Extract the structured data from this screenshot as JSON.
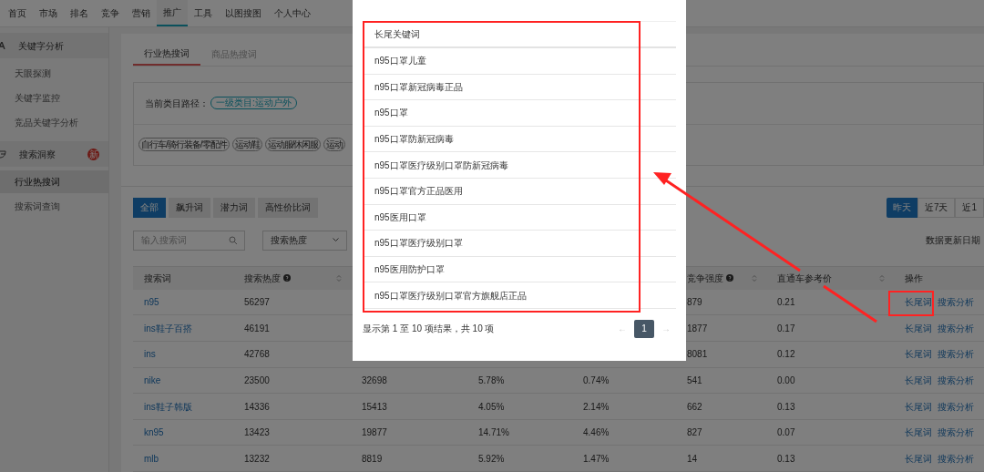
{
  "nav": [
    {
      "label": "首页",
      "selected": false
    },
    {
      "label": "市场",
      "selected": false
    },
    {
      "label": "排名",
      "selected": false
    },
    {
      "label": "竞争",
      "selected": false
    },
    {
      "label": "营销",
      "selected": false
    },
    {
      "label": "推广",
      "selected": true
    },
    {
      "label": "工具",
      "selected": false
    },
    {
      "label": "以图搜图",
      "selected": false
    },
    {
      "label": "个人中心",
      "selected": false
    }
  ],
  "sidebar": {
    "sections": [
      {
        "title": "关键字分析",
        "kind": "letter",
        "items": [
          {
            "label": "天眼探测",
            "selected": false
          },
          {
            "label": "关键字监控",
            "selected": false
          },
          {
            "label": "竞品关键字分析",
            "selected": false
          }
        ]
      },
      {
        "title": "搜索洞察",
        "kind": "scope",
        "badge": "新",
        "items": [
          {
            "label": "行业热搜词",
            "selected": true
          },
          {
            "label": "搜索词查询",
            "selected": false
          }
        ]
      }
    ]
  },
  "page_tabs": [
    {
      "label": "行业热搜词",
      "selected": true
    },
    {
      "label": "商品热搜词",
      "selected": false
    }
  ],
  "breadcrumb": {
    "label": "当前类目路径：",
    "value": "一级类目:运动户外"
  },
  "categories": [
    "自行车/骑行装备/零配件",
    "运动鞋",
    "运动服/休闲服",
    "运动"
  ],
  "filter_tabs": [
    {
      "label": "全部",
      "selected": true
    },
    {
      "label": "飙升词",
      "selected": false
    },
    {
      "label": "潜力词",
      "selected": false
    },
    {
      "label": "高性价比词",
      "selected": false
    }
  ],
  "period_tabs": [
    {
      "label": "昨天",
      "selected": true
    },
    {
      "label": "近7天",
      "selected": false
    },
    {
      "label": "近1",
      "selected": false
    }
  ],
  "search": {
    "placeholder": "输入搜索词"
  },
  "sort_select": {
    "value": "搜索热度"
  },
  "update_label": "数据更新日期",
  "table": {
    "columns": [
      {
        "label": "搜索词",
        "help": false,
        "sortable": false
      },
      {
        "label": "搜索热度",
        "help": true,
        "sortable": true
      },
      {
        "label": "竞争强度",
        "help": true,
        "sortable": true
      },
      {
        "label": "直通车参考价",
        "help": false,
        "sortable": true
      },
      {
        "label": "操作",
        "help": false,
        "sortable": false
      }
    ],
    "rows": [
      {
        "keyword": "n95",
        "heat": "56297",
        "competition": "879",
        "price": "0.21",
        "actions": [
          "长尾词",
          "搜索分析"
        ]
      },
      {
        "keyword": "ins鞋子百搭",
        "heat": "46191",
        "competition": "1877",
        "price": "0.17",
        "actions": [
          "长尾词",
          "搜索分析"
        ]
      },
      {
        "keyword": "ins",
        "heat": "42768",
        "competition": "8081",
        "price": "0.12",
        "actions": [
          "长尾词",
          "搜索分析"
        ]
      },
      {
        "keyword": "nike",
        "heat": "23500",
        "column_3": "32698",
        "column_4": "5.78%",
        "column_5": "0.74%",
        "competition": "541",
        "price": "0.00",
        "actions": [
          "长尾词",
          "搜索分析"
        ]
      },
      {
        "keyword": "ins鞋子韩版",
        "heat": "14336",
        "column_3": "15413",
        "column_4": "4.05%",
        "column_5": "2.14%",
        "competition": "662",
        "price": "0.13",
        "actions": [
          "长尾词",
          "搜索分析"
        ]
      },
      {
        "keyword": "kn95",
        "heat": "13423",
        "column_3": "19877",
        "column_4": "14.71%",
        "column_5": "4.46%",
        "competition": "827",
        "price": "0.07",
        "actions": [
          "长尾词",
          "搜索分析"
        ]
      },
      {
        "keyword": "mlb",
        "heat": "13232",
        "column_3": "8819",
        "column_4": "5.92%",
        "column_5": "1.47%",
        "competition": "14",
        "price": "0.13",
        "actions": [
          "长尾词",
          "搜索分析"
        ]
      }
    ]
  },
  "modal": {
    "header": "长尾关键词",
    "rows": [
      "n95口罩儿童",
      "n95口罩新冠病毒正品",
      "n95口罩",
      "n95口罩防新冠病毒",
      "n95口罩医疗级别口罩防新冠病毒",
      "n95口罩官方正品医用",
      "n95医用口罩",
      "n95口罩医疗级别口罩",
      "n95医用防护口罩",
      "n95口罩医疗级别口罩官方旗舰店正品"
    ],
    "summary": "显示第 1 至 10 项结果，共 10 项",
    "pagination": {
      "prev": "←",
      "pages": [
        {
          "label": "1",
          "selected": true
        }
      ],
      "next": "→"
    }
  }
}
